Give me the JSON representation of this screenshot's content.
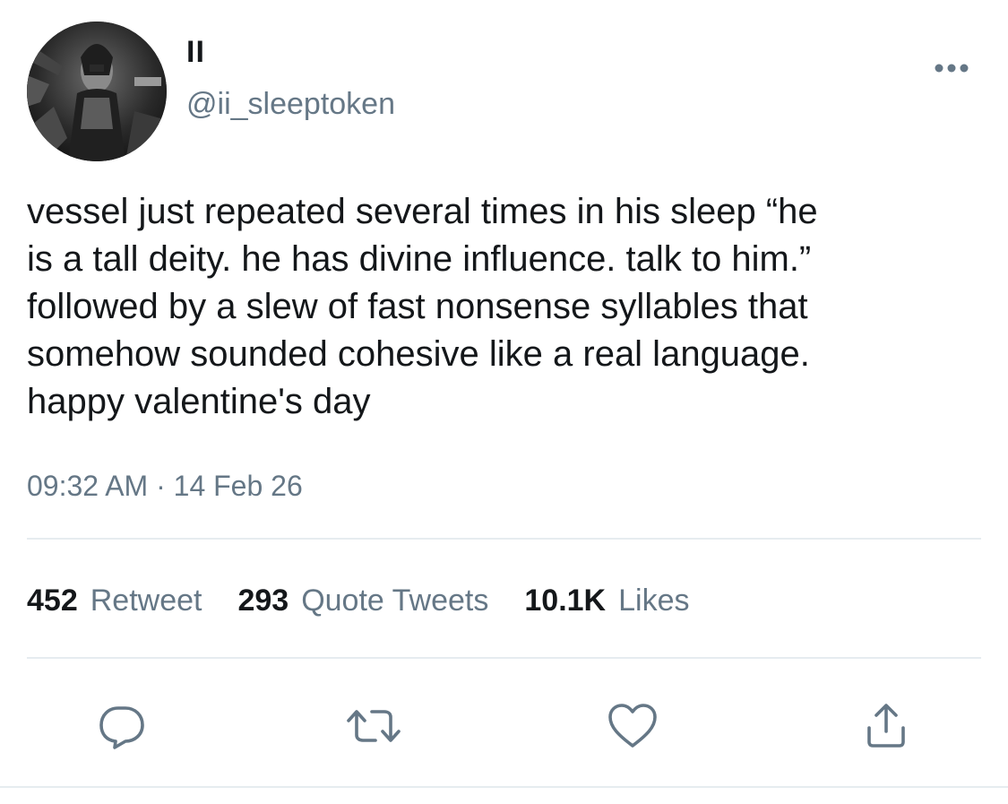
{
  "author": {
    "display_name": "II",
    "handle": "@ii_sleeptoken",
    "avatar_icon": "avatar-photo"
  },
  "tweet": {
    "text": "vessel just repeated several times in his sleep “he\nis a tall deity. he has divine influence. talk to him.”\nfollowed by a slew of fast nonsense syllables that\nsomehow sounded cohesive like a real language.\nhappy valentine's day",
    "timestamp": "09:32 AM · 14 Feb 26"
  },
  "stats": {
    "retweets": {
      "count": "452",
      "label": "Retweet"
    },
    "quotes": {
      "count": "293",
      "label": "Quote Tweets"
    },
    "likes": {
      "count": "10.1K",
      "label": "Likes"
    }
  },
  "actions": [
    {
      "icon": "reply-icon"
    },
    {
      "icon": "retweet-icon"
    },
    {
      "icon": "like-icon"
    },
    {
      "icon": "share-icon"
    }
  ],
  "menu": {
    "icon": "more-options-icon"
  },
  "colors": {
    "text": "#14171a",
    "secondary": "#657786",
    "divider": "#e6ecf0",
    "background": "#ffffff"
  }
}
